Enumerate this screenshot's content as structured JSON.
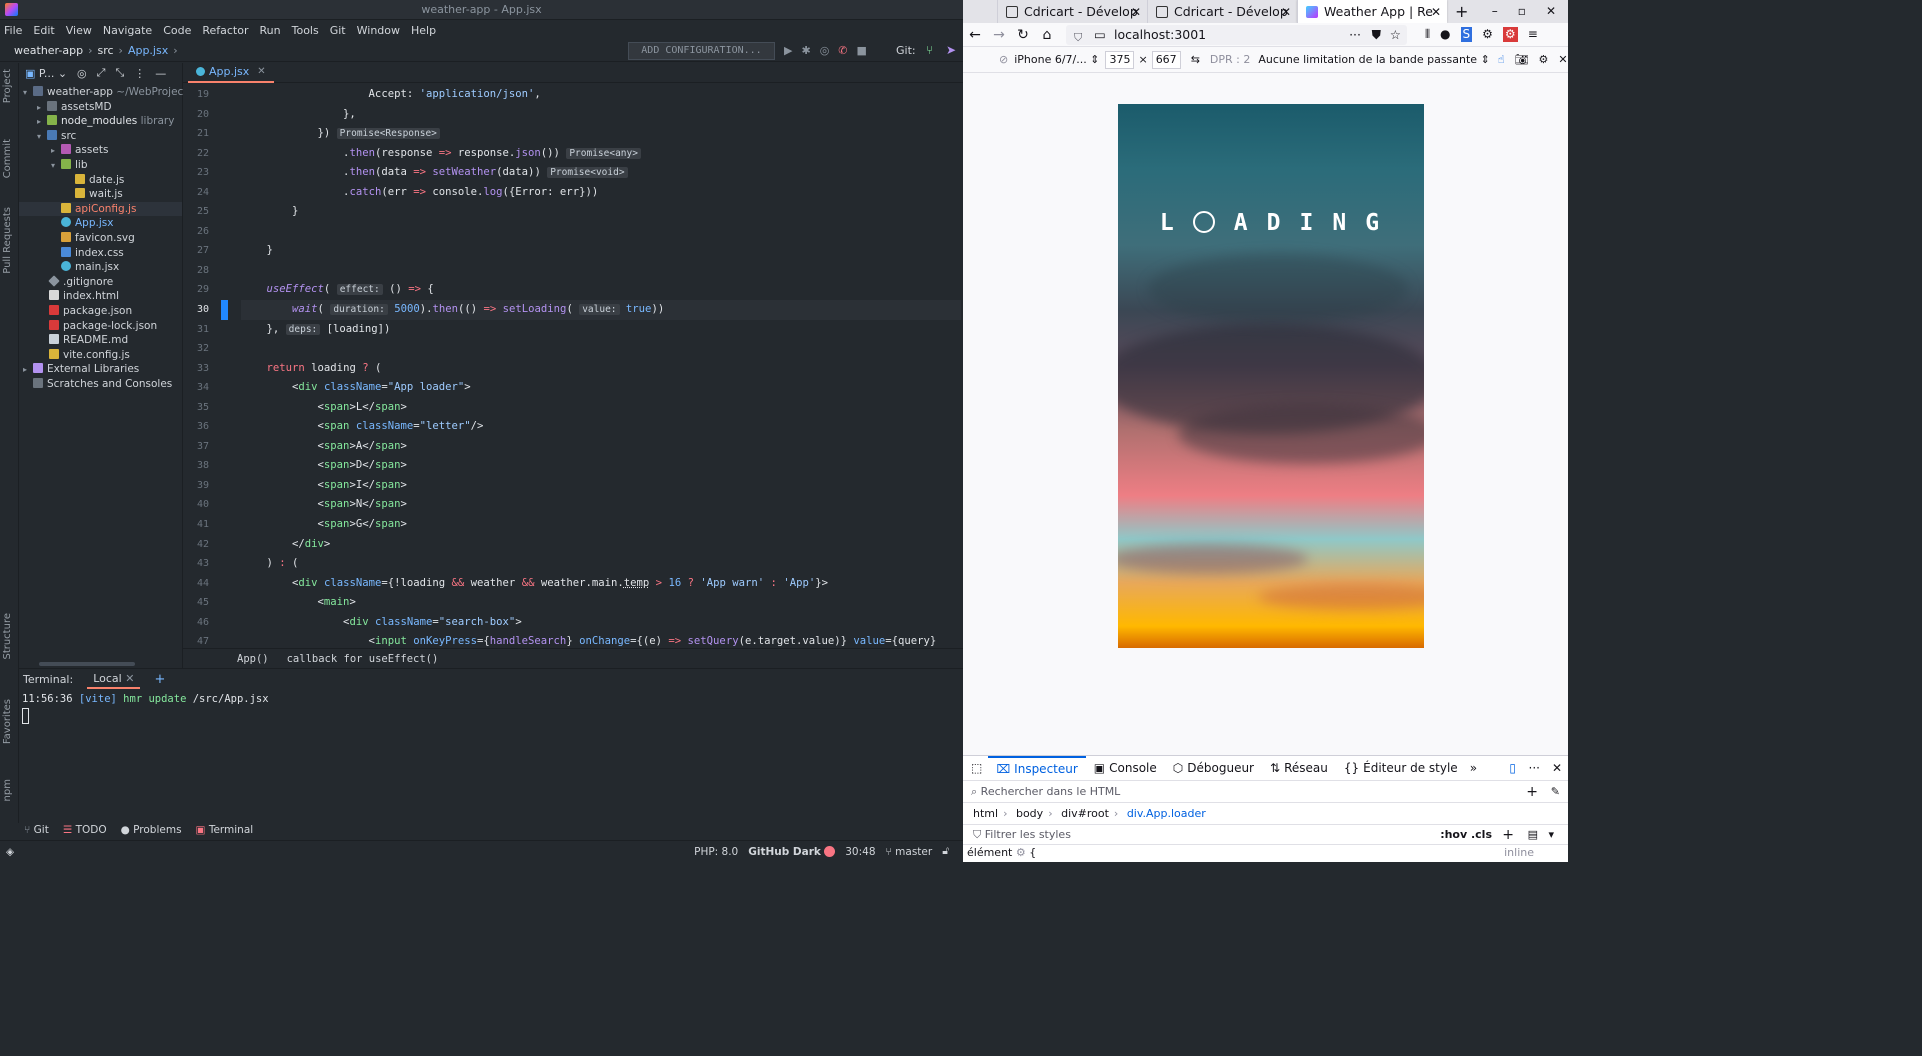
{
  "ide": {
    "title": "weather-app - App.jsx",
    "menu": [
      "File",
      "Edit",
      "View",
      "Navigate",
      "Code",
      "Refactor",
      "Run",
      "Tools",
      "Git",
      "Window",
      "Help"
    ],
    "nav": {
      "project": "weather-app",
      "folder": "src",
      "file": "App.jsx"
    },
    "add_config": "ADD CONFIGURATION...",
    "git_label": "Git:",
    "left_tabs": [
      "Project",
      "Commit",
      "Pull Requests",
      "Structure",
      "Favorites",
      "npm"
    ],
    "project_header": "P...",
    "tree": [
      {
        "label": "weather-app",
        "extra": "~/WebProjec"
      },
      {
        "label": "assetsMD"
      },
      {
        "label": "node_modules",
        "extra": "library"
      },
      {
        "label": "src"
      },
      {
        "label": "assets"
      },
      {
        "label": "lib"
      },
      {
        "label": "date.js"
      },
      {
        "label": "wait.js"
      },
      {
        "label": "apiConfig.js"
      },
      {
        "label": "App.jsx"
      },
      {
        "label": "favicon.svg"
      },
      {
        "label": "index.css"
      },
      {
        "label": "main.jsx"
      },
      {
        "label": ".gitignore"
      },
      {
        "label": "index.html"
      },
      {
        "label": "package.json"
      },
      {
        "label": "package-lock.json"
      },
      {
        "label": "README.md"
      },
      {
        "label": "vite.config.js"
      },
      {
        "label": "External Libraries"
      },
      {
        "label": "Scratches and Consoles"
      }
    ],
    "editor_tab": "App.jsx",
    "line_numbers": [
      "19",
      "20",
      "21",
      "22",
      "23",
      "24",
      "25",
      "26",
      "27",
      "28",
      "29",
      "30",
      "31",
      "32",
      "33",
      "34",
      "35",
      "36",
      "37",
      "38",
      "39",
      "40",
      "41",
      "42",
      "43",
      "44",
      "45",
      "46",
      "47"
    ],
    "code_hints": {
      "promise_response": "Promise<Response>",
      "promise_any": "Promise<any>",
      "promise_void": "Promise<void>",
      "effect": "effect:",
      "duration": "duration:",
      "value": "value:",
      "deps": "deps:"
    },
    "breadcrumb": [
      "App()",
      "callback for useEffect()"
    ],
    "terminal": {
      "label": "Terminal:",
      "tab": "Local",
      "time": "11:56:36",
      "tag": "[vite]",
      "msg": "hmr update",
      "path": "/src/App.jsx"
    },
    "bottom_tools": [
      "Git",
      "TODO",
      "Problems",
      "Terminal"
    ],
    "status": {
      "php": "PHP: 8.0",
      "theme": "GitHub Dark",
      "pos": "30:48",
      "branch": "master"
    }
  },
  "firefox": {
    "tabs": [
      "Cdricart - Dévelop",
      "Cdricart - Dévelop",
      "Weather App | Re"
    ],
    "url": "localhost:3001",
    "rdm": {
      "device": "iPhone 6/7/...",
      "width": "375",
      "height": "667",
      "dpr": "DPR : 2",
      "throttle": "Aucune limitation de la bande passante"
    },
    "page": {
      "loading_letters": [
        "L",
        "A",
        "D",
        "I",
        "N",
        "G"
      ]
    },
    "devtools": {
      "tabs": [
        "Inspecteur",
        "Console",
        "Débogueur",
        "Réseau",
        "Éditeur de style"
      ],
      "search_placeholder": "Rechercher dans le HTML",
      "crumbs": [
        "html",
        "body",
        "div#root",
        "div.App.loader"
      ],
      "filter_placeholder": "Filtrer les styles",
      "filter_right": ":hov .cls",
      "rule_sel": "élément",
      "rule_brace": "{",
      "rule_right": "inline"
    }
  },
  "colors": {
    "accent_orange": "#f9826c",
    "link_blue": "#79b8ff",
    "ff_blue": "#0061e0"
  }
}
